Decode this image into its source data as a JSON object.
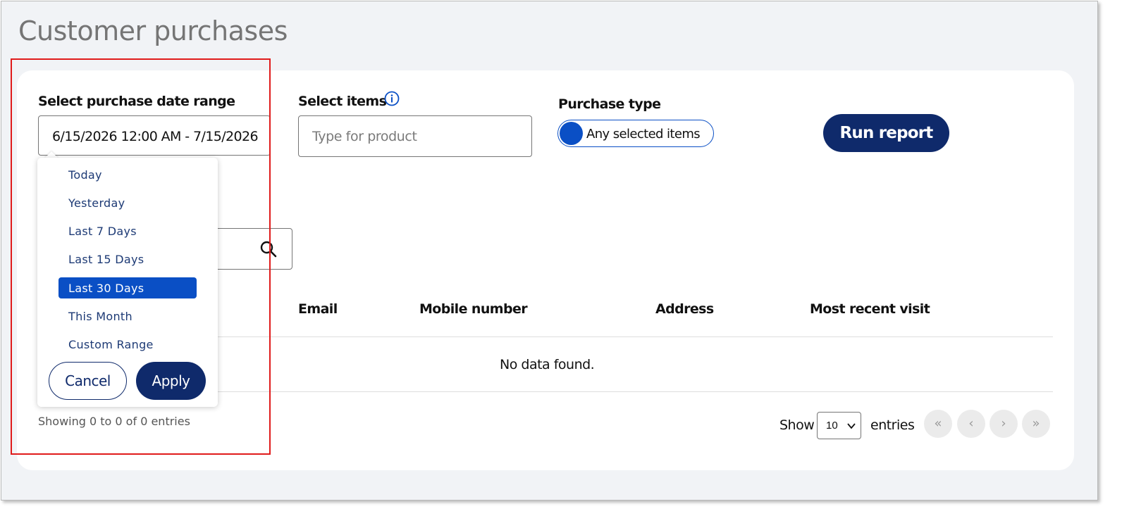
{
  "page": {
    "title": "Customer purchases"
  },
  "filters": {
    "date_range_label": "Select purchase date range",
    "date_range_value": "6/15/2026 12:00 AM - 7/15/2026",
    "items_label": "Select items",
    "items_placeholder": "Type for product",
    "info_icon": "info-circle-icon",
    "purchase_type_label": "Purchase type",
    "purchase_type_toggle": "Any selected items",
    "run_report": "Run report"
  },
  "date_dropdown": {
    "options": [
      "Today",
      "Yesterday",
      "Last 7 Days",
      "Last 15 Days",
      "Last 30 Days",
      "This Month",
      "Custom Range"
    ],
    "selected": "Last 30 Days",
    "cancel": "Cancel",
    "apply": "Apply"
  },
  "table": {
    "columns": [
      "Email",
      "Mobile number",
      "Address",
      "Most recent visit"
    ],
    "empty_message": "No data found."
  },
  "footer": {
    "showing": "Showing 0 to 0 of 0 entries",
    "show_label": "Show",
    "entries_value": "10",
    "entries_label": "entries",
    "pagination": [
      "«",
      "‹",
      "›",
      "»"
    ]
  },
  "colors": {
    "accent": "#0a4fc5",
    "primary_button": "#0f2a6b",
    "highlight_box": "#e01b1b"
  }
}
